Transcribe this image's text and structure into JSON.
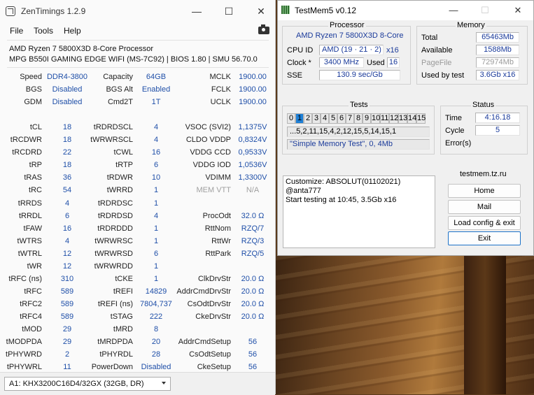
{
  "zentimings": {
    "title": "ZenTimings 1.2.9",
    "window_controls": {
      "minimize": "—",
      "maximize": "☐",
      "close": "✕"
    },
    "menu": [
      "File",
      "Tools",
      "Help"
    ],
    "cpu": "AMD Ryzen 7 5800X3D 8-Core Processor",
    "board": "MPG B550I GAMING EDGE WIFI (MS-7C92) | BIOS 1.80 | SMU 56.70.0",
    "rows": [
      [
        [
          "Speed",
          "DDR4-3800",
          false
        ],
        [
          "Capacity",
          "64GB",
          false
        ],
        [
          "MCLK",
          "1900.00",
          false
        ]
      ],
      [
        [
          "BGS",
          "Disabled",
          false
        ],
        [
          "BGS Alt",
          "Enabled",
          false
        ],
        [
          "FCLK",
          "1900.00",
          false
        ]
      ],
      [
        [
          "GDM",
          "Disabled",
          false
        ],
        [
          "Cmd2T",
          "1T",
          false
        ],
        [
          "UCLK",
          "1900.00",
          false
        ]
      ],
      [
        [
          "",
          "",
          false
        ],
        [
          "",
          "",
          false
        ],
        [
          "",
          "",
          false
        ]
      ],
      [
        [
          "tCL",
          "18",
          false
        ],
        [
          "tRDRDSCL",
          "4",
          false
        ],
        [
          "VSOC (SVI2)",
          "1,1375V",
          false
        ]
      ],
      [
        [
          "tRCDWR",
          "18",
          false
        ],
        [
          "tWRWRSCL",
          "4",
          false
        ],
        [
          "CLDO VDDP",
          "0,8324V",
          false
        ]
      ],
      [
        [
          "tRCDRD",
          "22",
          false
        ],
        [
          "tCWL",
          "16",
          false
        ],
        [
          "VDDG CCD",
          "0,9533V",
          false
        ]
      ],
      [
        [
          "tRP",
          "18",
          false
        ],
        [
          "tRTP",
          "6",
          false
        ],
        [
          "VDDG IOD",
          "1,0536V",
          false
        ]
      ],
      [
        [
          "tRAS",
          "36",
          false
        ],
        [
          "tRDWR",
          "10",
          false
        ],
        [
          "VDIMM",
          "1,3300V",
          false
        ]
      ],
      [
        [
          "tRC",
          "54",
          false
        ],
        [
          "tWRRD",
          "1",
          false
        ],
        [
          "MEM VTT",
          "N/A",
          true
        ]
      ],
      [
        [
          "tRRDS",
          "4",
          false
        ],
        [
          "tRDRDSC",
          "1",
          false
        ],
        [
          "",
          "",
          false
        ]
      ],
      [
        [
          "tRRDL",
          "6",
          false
        ],
        [
          "tRDRDSD",
          "4",
          false
        ],
        [
          "ProcOdt",
          "32.0 Ω",
          false
        ]
      ],
      [
        [
          "tFAW",
          "16",
          false
        ],
        [
          "tRDRDDD",
          "1",
          false
        ],
        [
          "RttNom",
          "RZQ/7",
          false
        ]
      ],
      [
        [
          "tWTRS",
          "4",
          false
        ],
        [
          "tWRWRSC",
          "1",
          false
        ],
        [
          "RttWr",
          "RZQ/3",
          false
        ]
      ],
      [
        [
          "tWTRL",
          "12",
          false
        ],
        [
          "tWRWRSD",
          "6",
          false
        ],
        [
          "RttPark",
          "RZQ/5",
          false
        ]
      ],
      [
        [
          "tWR",
          "12",
          false
        ],
        [
          "tWRWRDD",
          "1",
          false
        ],
        [
          "",
          "",
          false
        ]
      ],
      [
        [
          "tRFC (ns)",
          "310",
          false
        ],
        [
          "tCKE",
          "1",
          false
        ],
        [
          "ClkDrvStr",
          "20.0 Ω",
          false
        ]
      ],
      [
        [
          "tRFC",
          "589",
          false
        ],
        [
          "tREFI",
          "14829",
          false
        ],
        [
          "AddrCmdDrvStr",
          "20.0 Ω",
          false
        ]
      ],
      [
        [
          "tRFC2",
          "589",
          false
        ],
        [
          "tREFI (ns)",
          "7804,737",
          false
        ],
        [
          "CsOdtDrvStr",
          "20.0 Ω",
          false
        ]
      ],
      [
        [
          "tRFC4",
          "589",
          false
        ],
        [
          "tSTAG",
          "222",
          false
        ],
        [
          "CkeDrvStr",
          "20.0 Ω",
          false
        ]
      ],
      [
        [
          "tMOD",
          "29",
          false
        ],
        [
          "tMRD",
          "8",
          false
        ],
        [
          "",
          "",
          false
        ]
      ],
      [
        [
          "tMODPDA",
          "29",
          false
        ],
        [
          "tMRDPDA",
          "20",
          false
        ],
        [
          "AddrCmdSetup",
          "56",
          false
        ]
      ],
      [
        [
          "tPHYWRD",
          "2",
          false
        ],
        [
          "tPHYRDL",
          "28",
          false
        ],
        [
          "CsOdtSetup",
          "56",
          false
        ]
      ],
      [
        [
          "tPHYWRL",
          "11",
          false
        ],
        [
          "PowerDown",
          "Disabled",
          false
        ],
        [
          "CkeSetup",
          "56",
          false
        ]
      ]
    ],
    "dimm_selected": "A1: KHX3200C16D4/32GX (32GB, DR)"
  },
  "testmem": {
    "title": "TestMem5 v0.12",
    "window_controls": {
      "minimize": "—",
      "maximize": "☐",
      "close": "✕"
    },
    "processor": {
      "heading": "Processor",
      "name": "AMD Ryzen 7 5800X3D 8-Core",
      "cpu_id_label": "CPU ID",
      "cpu_id": "AMD  (19 · 21 · 2)",
      "cpu_threads": "x16",
      "clock_label": "Clock *",
      "clock": "3400 MHz",
      "used_label": "Used",
      "used": "16",
      "sse_label": "SSE",
      "sse": "130.9 sec/Gb"
    },
    "memory": {
      "heading": "Memory",
      "total_label": "Total",
      "total": "65463Mb",
      "available_label": "Available",
      "available": "1588Mb",
      "pagefile_label": "PageFile",
      "pagefile": "72974Mb",
      "used_by_test_label": "Used by test",
      "used_by_test": "3.6Gb x16"
    },
    "tests": {
      "heading": "Tests",
      "cells": [
        "0",
        "1",
        "2",
        "3",
        "4",
        "5",
        "6",
        "7",
        "8",
        "9",
        "10",
        "11",
        "12",
        "13",
        "14",
        "15"
      ],
      "active_index": 1,
      "sequence": "...5,2,11,15,4,2,12,15,5,14,15,1",
      "config": "\"Simple Memory Test\", 0, 4Mb"
    },
    "status": {
      "heading": "Status",
      "time_label": "Time",
      "time": "4:16.18",
      "cycle_label": "Cycle",
      "cycle": "5",
      "errors_label": "Error(s)",
      "errors": ""
    },
    "log": [
      "Customize: ABSOLUT(01102021) @anta777",
      "Start testing at 10:45, 3.5Gb x16"
    ],
    "site": "testmem.tz.ru",
    "buttons": {
      "home": "Home",
      "mail": "Mail",
      "load": "Load config & exit",
      "exit": "Exit"
    }
  }
}
